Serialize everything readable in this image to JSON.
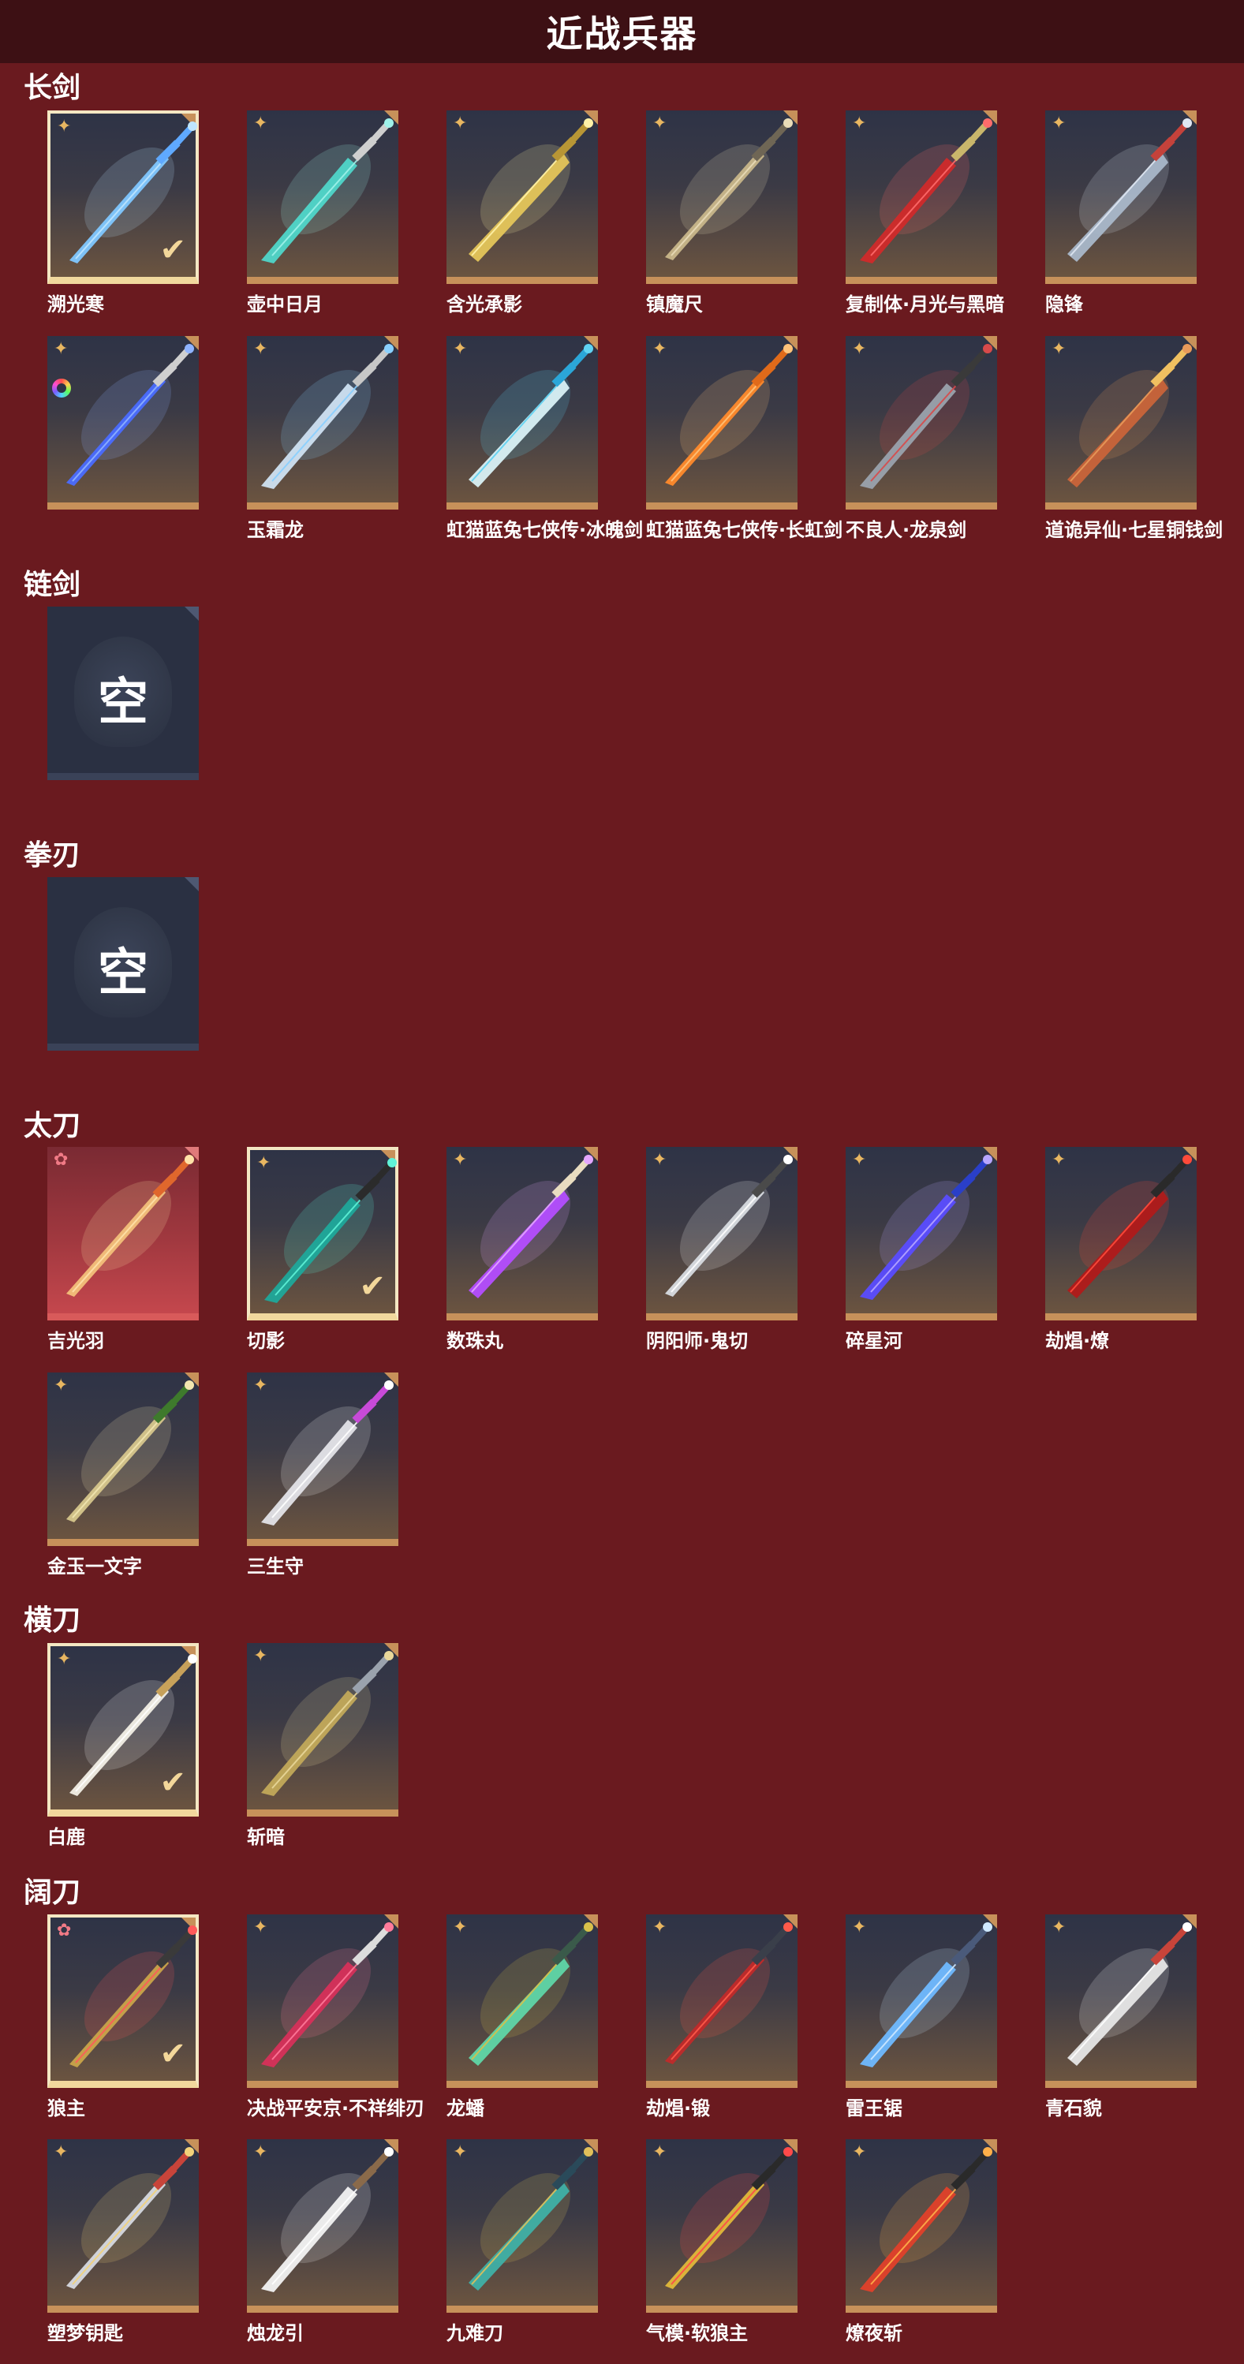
{
  "header": {
    "title": "近战兵器"
  },
  "sections": [
    {
      "title": "长剑",
      "items": [
        {
          "name": "溯光寒",
          "rarity": "gold",
          "selected": true,
          "color": "#7fc7ff",
          "glow": "#bfe6ff",
          "accent": "#5fa9ff"
        },
        {
          "name": "壶中日月",
          "rarity": "gold",
          "selected": false,
          "color": "#4fd6c9",
          "glow": "#9ff2ea",
          "accent": "#cfcfcf"
        },
        {
          "name": "含光承影",
          "rarity": "gold",
          "selected": false,
          "color": "#e4c55a",
          "glow": "#fff2a8",
          "accent": "#b89635"
        },
        {
          "name": "镇魔尺",
          "rarity": "gold",
          "selected": false,
          "color": "#c8b68a",
          "glow": "#e9dcb8",
          "accent": "#6f6655"
        },
        {
          "name": "复制体·月光与黑暗",
          "rarity": "gold",
          "selected": false,
          "color": "#d02a2a",
          "glow": "#ff6b6b",
          "accent": "#c9b66b"
        },
        {
          "name": "隐锋",
          "rarity": "gold",
          "selected": false,
          "color": "#a9b7c9",
          "glow": "#dfe7f2",
          "accent": "#c4423b"
        },
        {
          "name": "",
          "rarity": "gold",
          "selected": false,
          "ring": true,
          "color": "#4a6cff",
          "glow": "#8fb3ff",
          "accent": "#cfcfcf"
        },
        {
          "name": "玉霜龙",
          "rarity": "gold",
          "selected": false,
          "color": "#cfe2f2",
          "glow": "#89d0ff",
          "accent": "#c7c7c7"
        },
        {
          "name": "虹猫蓝兔七侠传·冰魄剑",
          "rarity": "gold",
          "selected": false,
          "color": "#d9f1f6",
          "glow": "#5fd2f2",
          "accent": "#2ba6d8"
        },
        {
          "name": "虹猫蓝兔七侠传·长虹剑",
          "rarity": "gold",
          "selected": false,
          "color": "#ff8a2b",
          "glow": "#ffc37a",
          "accent": "#e06a1a"
        },
        {
          "name": "不良人·龙泉剑",
          "rarity": "gold",
          "selected": false,
          "color": "#9aa2ad",
          "glow": "#d84a4a",
          "accent": "#3a3a3a"
        },
        {
          "name": "道诡异仙·七星铜钱剑",
          "rarity": "gold",
          "selected": false,
          "color": "#c9643a",
          "glow": "#e89a5a",
          "accent": "#f0c060"
        }
      ]
    },
    {
      "title": "链剑",
      "items": [
        {
          "name": "",
          "empty": true,
          "empty_label": "空"
        }
      ]
    },
    {
      "title": "拳刃",
      "items": [
        {
          "name": "",
          "empty": true,
          "empty_label": "空"
        }
      ]
    },
    {
      "title": "太刀",
      "items": [
        {
          "name": "吉光羽",
          "rarity": "pink",
          "red": true,
          "selected": false,
          "color": "#f2c07a",
          "glow": "#ffe2a8",
          "accent": "#e0672c"
        },
        {
          "name": "切影",
          "rarity": "gold",
          "selected": true,
          "color": "#1fa89a",
          "glow": "#5ff2d8",
          "accent": "#2b2b2b"
        },
        {
          "name": "数珠丸",
          "rarity": "gold",
          "selected": false,
          "color": "#b44dff",
          "glow": "#e3a6ff",
          "accent": "#e8dcc0"
        },
        {
          "name": "阴阳师·鬼切",
          "rarity": "gold",
          "selected": false,
          "color": "#d7dbe0",
          "glow": "#ffffff",
          "accent": "#4a4a4a"
        },
        {
          "name": "碎星河",
          "rarity": "gold",
          "selected": false,
          "color": "#5a4cff",
          "glow": "#b7a6ff",
          "accent": "#2a3fc8"
        },
        {
          "name": "劫焻·燎",
          "rarity": "gold",
          "selected": false,
          "color": "#b01a1a",
          "glow": "#ff4a3a",
          "accent": "#2a2a2a"
        },
        {
          "name": "金玉一文字",
          "rarity": "gold",
          "selected": false,
          "color": "#d6c68c",
          "glow": "#f2e6b0",
          "accent": "#3e7a2c"
        },
        {
          "name": "三生守",
          "rarity": "gold",
          "selected": false,
          "color": "#e3e3e8",
          "glow": "#ffffff",
          "accent": "#c84ad8"
        }
      ]
    },
    {
      "title": "横刀",
      "items": [
        {
          "name": "白鹿",
          "rarity": "gold",
          "selected": true,
          "color": "#f2efe6",
          "glow": "#ffffff",
          "accent": "#c7a15a"
        },
        {
          "name": "斩暗",
          "rarity": "gold",
          "selected": false,
          "color": "#c2a95a",
          "glow": "#e9d79a",
          "accent": "#9aa2ad"
        }
      ]
    },
    {
      "title": "阔刀",
      "items": [
        {
          "name": "狼主",
          "rarity": "pink",
          "selected": true,
          "color": "#c9a44a",
          "glow": "#ff5a5a",
          "accent": "#3a3a3a"
        },
        {
          "name": "决战平安京·不祥绯刃",
          "rarity": "gold",
          "selected": false,
          "color": "#d6305a",
          "glow": "#ff7a9a",
          "accent": "#dcdcdc"
        },
        {
          "name": "龙蟠",
          "rarity": "gold",
          "selected": false,
          "color": "#5fd6a8",
          "glow": "#d8c04a",
          "accent": "#3a5a4a"
        },
        {
          "name": "劫焻·锻",
          "rarity": "gold",
          "selected": false,
          "color": "#c02a2a",
          "glow": "#ff5a4a",
          "accent": "#3a3f4a"
        },
        {
          "name": "雷王锯",
          "rarity": "gold",
          "selected": false,
          "color": "#6fb9ff",
          "glow": "#cfe9ff",
          "accent": "#4a5a7a"
        },
        {
          "name": "青石貌",
          "rarity": "gold",
          "selected": false,
          "color": "#e6e6e6",
          "glow": "#ffffff",
          "accent": "#c8443a"
        },
        {
          "name": "塑梦钥匙",
          "rarity": "gold",
          "selected": false,
          "color": "#d6d9e0",
          "glow": "#f2d27a",
          "accent": "#c8443a"
        },
        {
          "name": "烛龙引",
          "rarity": "gold",
          "selected": false,
          "color": "#f2f2f2",
          "glow": "#ffffff",
          "accent": "#8a6a4a"
        },
        {
          "name": "九难刀",
          "rarity": "gold",
          "selected": false,
          "color": "#3fb0a6",
          "glow": "#e0c05a",
          "accent": "#2a4a5a"
        },
        {
          "name": "气模·软狼主",
          "rarity": "gold",
          "selected": false,
          "color": "#e0b83a",
          "glow": "#ff4a4a",
          "accent": "#2a2a2a"
        },
        {
          "name": "燎夜斩",
          "rarity": "gold",
          "selected": false,
          "color": "#e0402a",
          "glow": "#ffb04a",
          "accent": "#2a2a2a"
        }
      ]
    }
  ]
}
